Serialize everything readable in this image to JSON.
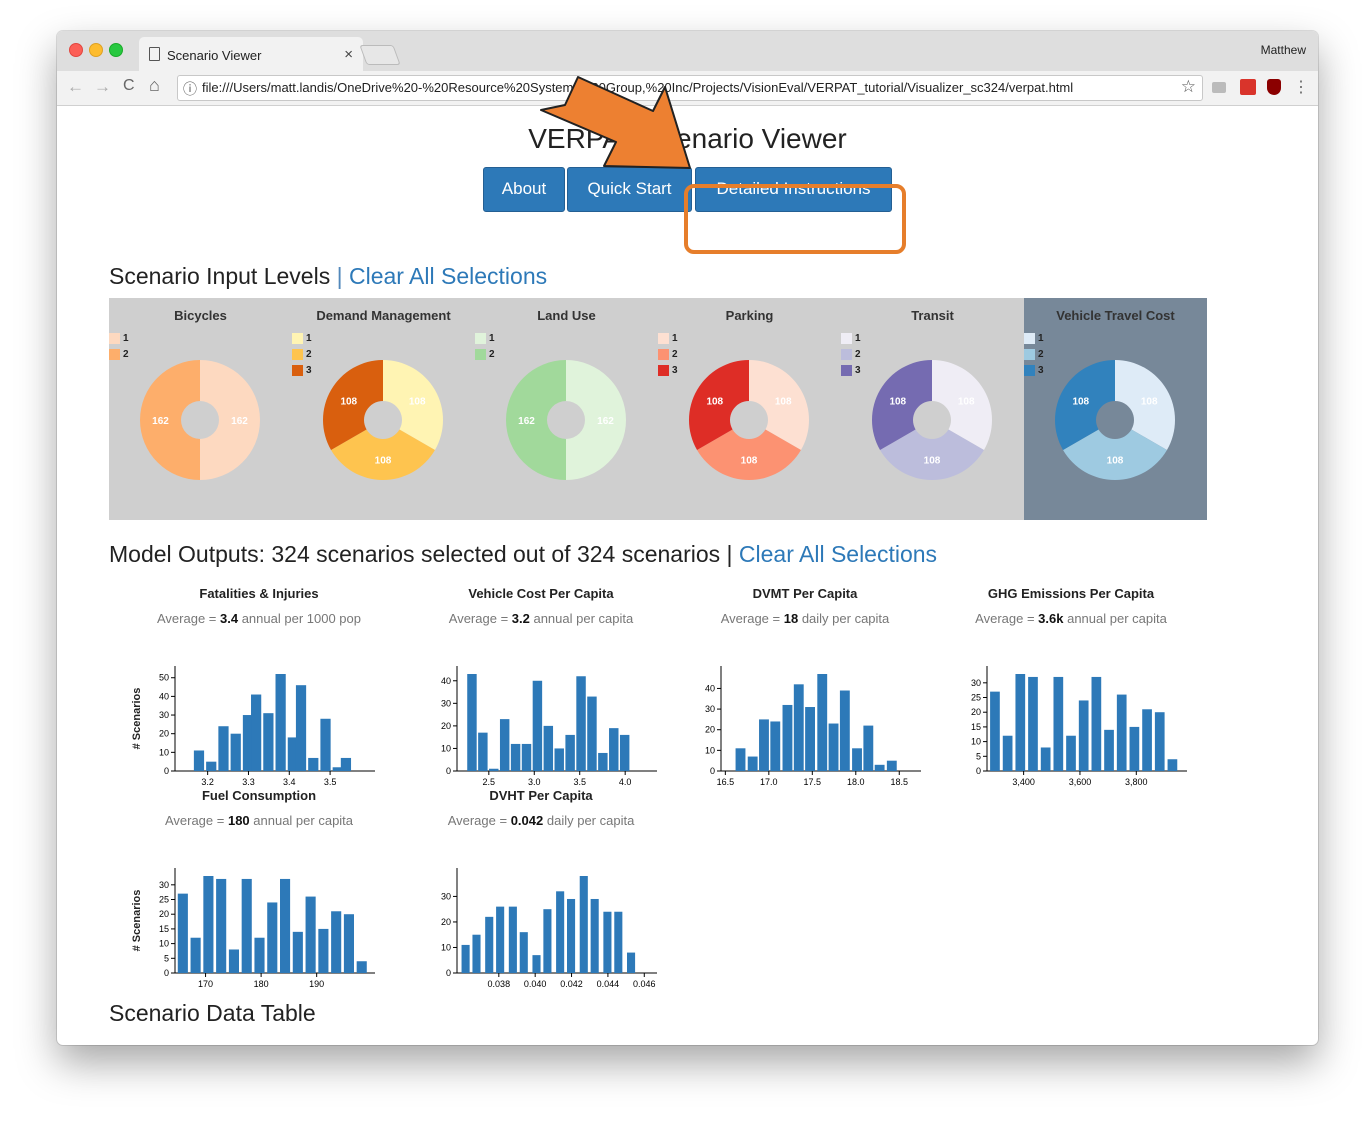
{
  "browser": {
    "tab_title": "Scenario Viewer",
    "tab_close": "×",
    "user": "Matthew",
    "url": "file:///Users/matt.landis/OneDrive%20-%20Resource%20Systems%20Group,%20Inc/Projects/VisionEval/VERPAT_tutorial/Visualizer_sc324/verpat.html",
    "back": "←",
    "forward": "→",
    "reload": "C",
    "home": "⌂",
    "info": "ⓘ",
    "star": "☆",
    "menu": "⋮"
  },
  "page": {
    "title": "VERPAT Scenario Viewer",
    "buttons": {
      "about": "About",
      "quick_start": "Quick Start",
      "detailed": "Detailed Instructions"
    },
    "inputs_title": "Scenario Input Levels",
    "sep": "|",
    "clear_all": "Clear All Selections",
    "outputs_title": "Model Outputs: 324 scenarios selected out of 324 scenarios",
    "table_title": "Scenario Data Table",
    "table_headers": [
      "Bicycles",
      "Demand Management",
      "Land Use",
      "Parking",
      "Transit",
      "Vehicle Travel Cost",
      "Fatalities/Injuries",
      "Vehicle Cost",
      "DVMT",
      "GHG Emissions",
      "Fuel",
      "DVHT"
    ],
    "y_axis_label": "# Scenarios"
  },
  "inputs": [
    {
      "name": "Bicycles",
      "levels": [
        "1",
        "2"
      ],
      "values": [
        162,
        162
      ],
      "colors": [
        "#fdd9c0",
        "#fdae6b"
      ],
      "selected": false
    },
    {
      "name": "Demand Management",
      "levels": [
        "1",
        "2",
        "3"
      ],
      "values": [
        108,
        108,
        108
      ],
      "colors": [
        "#fff4b3",
        "#fec44f",
        "#d95f0e"
      ],
      "selected": false
    },
    {
      "name": "Land Use",
      "levels": [
        "1",
        "2"
      ],
      "values": [
        162,
        162
      ],
      "colors": [
        "#e0f3db",
        "#a1d99b"
      ],
      "selected": false
    },
    {
      "name": "Parking",
      "levels": [
        "1",
        "2",
        "3"
      ],
      "values": [
        108,
        108,
        108
      ],
      "colors": [
        "#fde0d2",
        "#fc9272",
        "#de2d26"
      ],
      "selected": false
    },
    {
      "name": "Transit",
      "levels": [
        "1",
        "2",
        "3"
      ],
      "values": [
        108,
        108,
        108
      ],
      "colors": [
        "#efedf5",
        "#bcbddc",
        "#756bb1"
      ],
      "selected": false
    },
    {
      "name": "Vehicle Travel Cost",
      "levels": [
        "1",
        "2",
        "3"
      ],
      "values": [
        108,
        108,
        108
      ],
      "colors": [
        "#deebf7",
        "#9ecae1",
        "#3182bd"
      ],
      "selected": true
    }
  ],
  "chart_data": [
    {
      "type": "bar",
      "title": "Fatalities & Injuries",
      "avg_prefix": "Average = ",
      "avg_value": "3.4",
      "avg_unit": " annual per 1000 pop",
      "ylabel": "# Scenarios",
      "xlim": [
        3.12,
        3.61
      ],
      "ylim": [
        0,
        52
      ],
      "xticks": [
        3.2,
        3.3,
        3.4,
        3.5
      ],
      "xtick_labels": [
        "3.2",
        "3.3",
        "3.4",
        "3.5"
      ],
      "yticks": [
        0,
        10,
        20,
        30,
        40,
        50
      ],
      "bin_width": 0.0275,
      "x": [
        3.15,
        3.18,
        3.21,
        3.24,
        3.27,
        3.3,
        3.32,
        3.35,
        3.38,
        3.41,
        3.43,
        3.46,
        3.49,
        3.52,
        3.54,
        3.57
      ],
      "values": [
        0,
        11,
        5,
        24,
        20,
        30,
        41,
        31,
        52,
        18,
        46,
        7,
        28,
        2,
        7,
        0
      ]
    },
    {
      "type": "bar",
      "title": "Vehicle Cost Per Capita",
      "avg_prefix": "Average = ",
      "avg_value": "3.2",
      "avg_unit": " annual per capita",
      "ylabel": "",
      "xlim": [
        2.15,
        4.35
      ],
      "ylim": [
        0,
        43
      ],
      "xticks": [
        2.5,
        3.0,
        3.5,
        4.0
      ],
      "xtick_labels": [
        "2.5",
        "3.0",
        "3.5",
        "4.0"
      ],
      "yticks": [
        0,
        10,
        20,
        30,
        40
      ],
      "bin_width": 0.115,
      "x": [
        2.2,
        2.32,
        2.44,
        2.56,
        2.68,
        2.8,
        2.92,
        3.04,
        3.16,
        3.28,
        3.4,
        3.52,
        3.64,
        3.76,
        3.88,
        4.0,
        4.12,
        4.24
      ],
      "values": [
        0,
        43,
        17,
        1,
        23,
        12,
        12,
        40,
        20,
        10,
        16,
        42,
        33,
        8,
        19,
        16,
        0,
        0
      ]
    },
    {
      "type": "bar",
      "title": "DVMT Per Capita",
      "avg_prefix": "Average = ",
      "avg_value": "18",
      "avg_unit": " daily per capita",
      "ylabel": "",
      "xlim": [
        16.45,
        18.75
      ],
      "ylim": [
        0,
        47
      ],
      "xticks": [
        16.5,
        17.0,
        17.5,
        18.0,
        18.5
      ],
      "xtick_labels": [
        "16.5",
        "17.0",
        "17.5",
        "18.0",
        "18.5"
      ],
      "yticks": [
        0,
        10,
        20,
        30,
        40
      ],
      "bin_width": 0.125,
      "x": [
        16.55,
        16.68,
        16.82,
        16.95,
        17.08,
        17.22,
        17.35,
        17.48,
        17.62,
        17.75,
        17.88,
        18.02,
        18.15,
        18.28,
        18.42,
        18.55
      ],
      "values": [
        0,
        11,
        7,
        25,
        24,
        32,
        42,
        31,
        47,
        23,
        39,
        11,
        22,
        3,
        5,
        0
      ]
    },
    {
      "type": "bar",
      "title": "GHG Emissions Per Capita",
      "avg_prefix": "Average = ",
      "avg_value": "3.6k",
      "avg_unit": " annual per capita",
      "ylabel": "",
      "xlim": [
        3270,
        3980
      ],
      "ylim": [
        0,
        33
      ],
      "xticks": [
        3400,
        3600,
        3800
      ],
      "xtick_labels": [
        "3,400",
        "3,600",
        "3,800"
      ],
      "yticks": [
        0,
        5,
        10,
        15,
        20,
        25,
        30
      ],
      "bin_width": 38,
      "x": [
        3300,
        3345,
        3390,
        3435,
        3480,
        3525,
        3570,
        3615,
        3660,
        3705,
        3750,
        3795,
        3840,
        3885,
        3930
      ],
      "values": [
        27,
        12,
        33,
        32,
        8,
        32,
        12,
        24,
        32,
        14,
        26,
        15,
        21,
        20,
        4
      ]
    },
    {
      "type": "bar",
      "title": "Fuel Consumption",
      "avg_prefix": "Average = ",
      "avg_value": "180",
      "avg_unit": " annual per capita",
      "ylabel": "# Scenarios",
      "xlim": [
        164.5,
        200.5
      ],
      "ylim": [
        0,
        33
      ],
      "xticks": [
        170,
        180,
        190
      ],
      "xtick_labels": [
        "170",
        "180",
        "190"
      ],
      "yticks": [
        0,
        5,
        10,
        15,
        20,
        25,
        30
      ],
      "bin_width": 2.0,
      "x": [
        166,
        168.3,
        170.6,
        172.9,
        175.2,
        177.5,
        179.8,
        182.1,
        184.4,
        186.7,
        189,
        191.3,
        193.6,
        195.9,
        198.2
      ],
      "values": [
        27,
        12,
        33,
        32,
        8,
        32,
        12,
        24,
        32,
        14,
        26,
        15,
        21,
        20,
        4
      ]
    },
    {
      "type": "bar",
      "title": "DVHT Per Capita",
      "avg_prefix": "Average = ",
      "avg_value": "0.042",
      "avg_unit": " daily per capita",
      "ylabel": "",
      "xlim": [
        0.0357,
        0.0467
      ],
      "ylim": [
        0,
        38
      ],
      "xticks": [
        0.038,
        0.04,
        0.042,
        0.044,
        0.046
      ],
      "xtick_labels": [
        "0.038",
        "0.040",
        "0.042",
        "0.044",
        "0.046"
      ],
      "yticks": [
        0,
        10,
        20,
        30
      ],
      "bin_width": 0.0005,
      "x": [
        0.0362,
        0.0368,
        0.0375,
        0.0381,
        0.0388,
        0.0394,
        0.0401,
        0.0407,
        0.0414,
        0.042,
        0.0427,
        0.0433,
        0.044,
        0.0446,
        0.0453,
        0.0459
      ],
      "values": [
        11,
        15,
        22,
        26,
        26,
        16,
        7,
        25,
        32,
        29,
        38,
        29,
        24,
        24,
        8,
        0
      ]
    }
  ],
  "colors": {
    "bar": "#2d79b8",
    "button": "#2d79b8",
    "highlight": "#e67e2b",
    "panel_selected": "#778899",
    "panel_bg": "#cfcfcf"
  },
  "icons": [
    "close-icon",
    "page-icon",
    "back-icon",
    "forward-icon",
    "reload-icon",
    "home-icon",
    "info-icon",
    "star-icon",
    "menu-icon",
    "arrow-annotation-icon"
  ]
}
